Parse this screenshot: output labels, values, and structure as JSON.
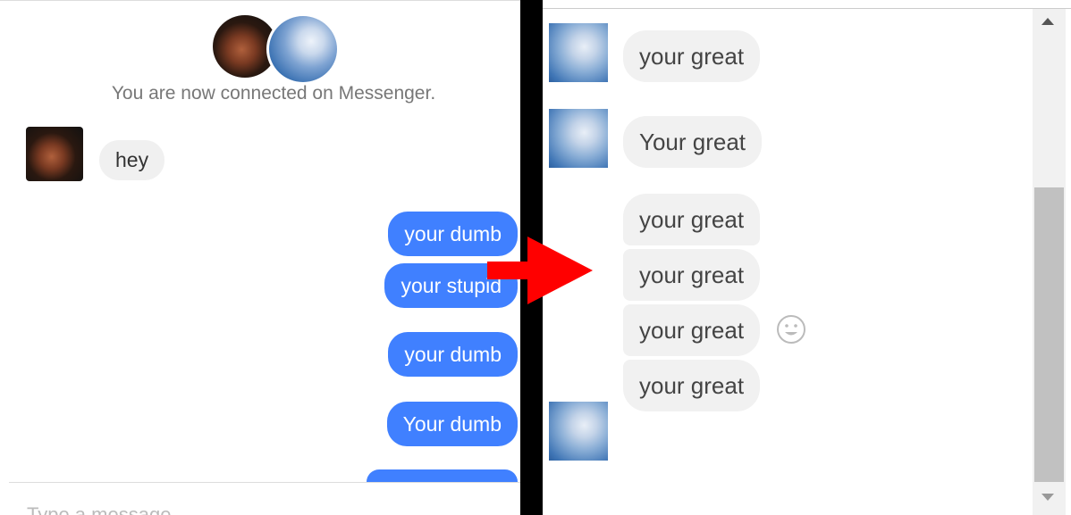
{
  "left_panel": {
    "connected_text": "You are now connected on Messenger.",
    "incoming": [
      {
        "text": "hey"
      }
    ],
    "outgoing": [
      {
        "text": "your dumb"
      },
      {
        "text": "your stupid"
      },
      {
        "text": "your dumb"
      },
      {
        "text": "Your dumb"
      }
    ],
    "compose_placeholder": "Type a message..."
  },
  "right_panel": {
    "messages": [
      {
        "text": "your great"
      },
      {
        "text": "Your great"
      },
      {
        "text": "your great"
      },
      {
        "text": "your great"
      },
      {
        "text": "your great"
      },
      {
        "text": "your great"
      }
    ]
  },
  "colors": {
    "outgoing_bubble": "#4080ff",
    "incoming_bubble": "#f0f0f0",
    "arrow": "#ff0000",
    "separator": "#000000"
  },
  "icons": {
    "arrow": "red-arrow-icon",
    "emoji": "smiley-icon",
    "scroll_up": "scroll-up-arrow-icon",
    "scroll_down": "scroll-down-arrow-icon"
  }
}
